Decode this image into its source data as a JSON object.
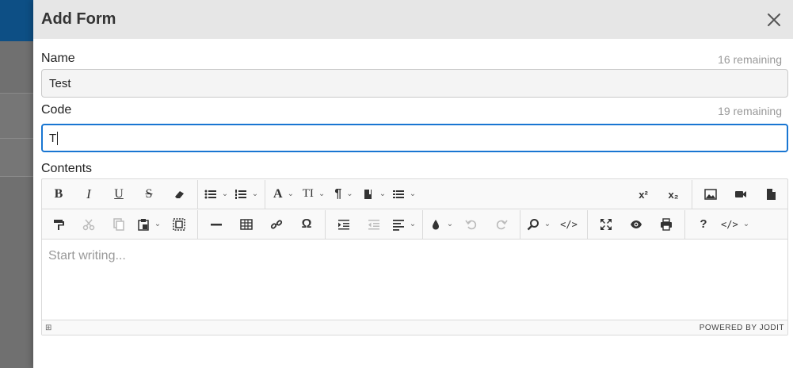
{
  "dialog": {
    "title": "Add Form",
    "close_icon": "close-icon"
  },
  "form": {
    "name": {
      "label": "Name",
      "remaining": "16 remaining",
      "value": "Test"
    },
    "code": {
      "label": "Code",
      "remaining": "19 remaining",
      "value": "T"
    },
    "contents": {
      "label": "Contents",
      "placeholder": "Start writing..."
    }
  },
  "editor": {
    "toolbar_row1": [
      "bold-icon",
      "italic-icon",
      "underline-icon",
      "strikethrough-icon",
      "eraser-icon",
      "bullet-list-icon",
      "numbered-list-icon",
      "font-icon",
      "font-size-icon",
      "paragraph-icon",
      "classes-icon",
      "line-height-icon"
    ],
    "toolbar_row1_right": [
      "superscript-icon",
      "subscript-icon",
      "image-icon",
      "video-icon",
      "file-icon"
    ],
    "toolbar_row2": [
      "copy-format-icon",
      "cut-icon",
      "copy-icon",
      "paste-icon",
      "select-all-icon",
      "hr-icon",
      "table-icon",
      "link-icon",
      "symbols-icon",
      "indent-icon",
      "outdent-icon",
      "align-icon",
      "brush-icon",
      "undo-icon",
      "redo-icon",
      "find-icon",
      "source-icon",
      "fullsize-icon",
      "preview-icon",
      "print-icon",
      "about-icon",
      "source-dropdown-icon"
    ],
    "labels": {
      "bold": "B",
      "italic": "I",
      "underline": "U",
      "strike": "S",
      "font": "A",
      "font_size": "TI",
      "paragraph": "¶",
      "superscript": "x²",
      "subscript": "x₂",
      "symbols": "Ω",
      "about": "?",
      "source": "</>"
    },
    "status": "POWERED BY JODIT"
  },
  "colors": {
    "accent": "#1976d2",
    "header_bg": "#e6e6e6",
    "app_bar": "#0d4f85"
  }
}
